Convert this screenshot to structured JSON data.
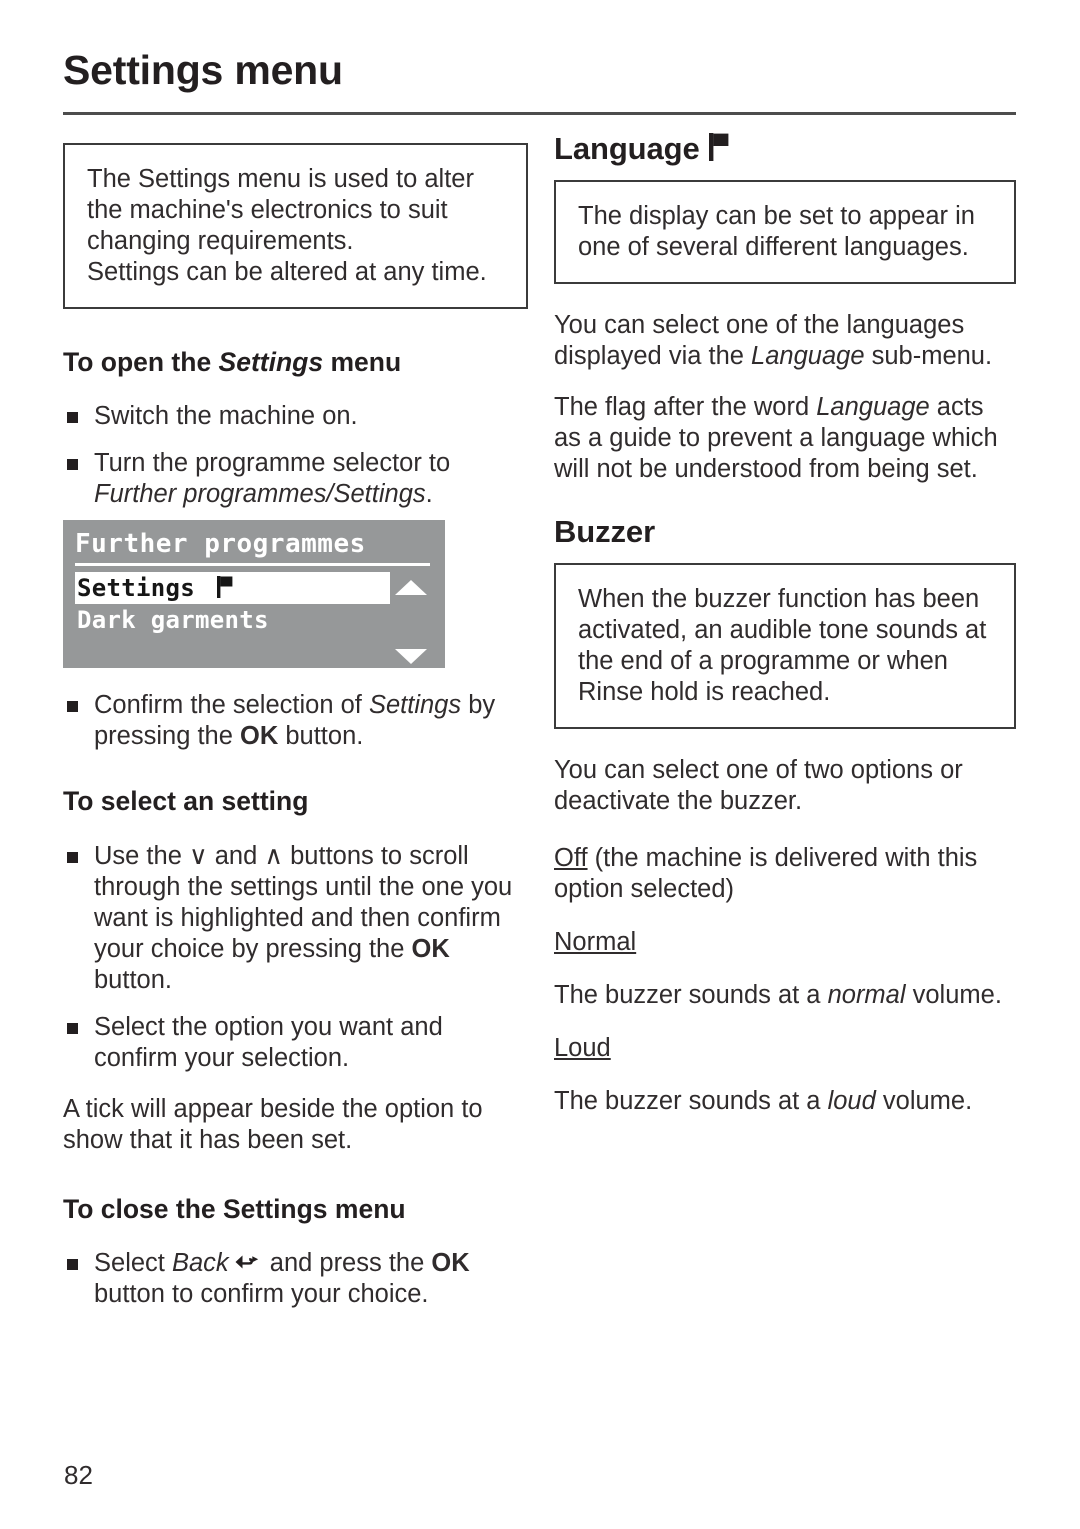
{
  "document": {
    "page_title": "Settings menu",
    "page_number": "82"
  },
  "left_column": {
    "intro_box": {
      "line1": "The Settings menu is used to alter the machine's electronics to suit changing requirements.",
      "line2": "Settings can be altered at any time."
    },
    "heading_open": {
      "part1": "To open the ",
      "italic": "Settings",
      "part2": " menu"
    },
    "bullet_switch_on": "Switch the machine on.",
    "bullet_turn_selector": {
      "text": "Turn the programme selector to ",
      "italic": "Further programmes/Settings",
      "tail": "."
    },
    "lcd": {
      "title": "Further programmes",
      "row_selected": "Settings",
      "row_selected_icon": "flag-icon",
      "row_next": "Dark garments",
      "scroll_up_icon": "triangle-up-icon",
      "scroll_down_icon": "triangle-down-icon"
    },
    "bullet_confirm": {
      "part1": "Confirm the selection of ",
      "italic": "Settings",
      "part2": " by pressing the ",
      "bold": "OK",
      "part3": " button."
    },
    "heading_select": "To select an setting",
    "bullet_use_buttons": {
      "part1": "Use the ",
      "sym_down": "∨",
      "part2": " and ",
      "sym_up": "∧",
      "part3": "  buttons to scroll through the settings until the one you want is highlighted and then confirm your choice by pressing the ",
      "bold": "OK",
      "part4": " button."
    },
    "bullet_select_option": "Select the option you want and confirm your selection.",
    "tick_paragraph": "A tick will appear beside the option to show that it has been set.",
    "heading_close": "To close the Settings menu",
    "bullet_back": {
      "part1": "Select ",
      "italic": "Back",
      "icon": "back-arrow-icon",
      "part2": " and press the ",
      "bold": "OK",
      "part3": " button to confirm your choice."
    }
  },
  "right_column": {
    "language": {
      "heading": "Language",
      "heading_icon": "flag-icon",
      "note_box": "The display can be set to appear in one of several different languages.",
      "para1": {
        "part1": "You can select one of the languages displayed via the ",
        "italic": "Language",
        "part2": " sub-menu."
      },
      "para2": {
        "part1": "The flag after the word ",
        "italic": "Language",
        "part2": " acts as a guide to prevent a language which will not be understood from being set."
      }
    },
    "buzzer": {
      "heading": "Buzzer",
      "note_box": "When the buzzer function has been activated, an audible tone sounds at the end of a programme or when Rinse hold is reached.",
      "para1": "You can select one of two options or deactivate the buzzer.",
      "option_off": {
        "underlined": "Off",
        "rest": " (the machine is delivered with this option selected)"
      },
      "option_normal": {
        "underlined": "Normal",
        "description": {
          "part1": "The buzzer sounds at a ",
          "italic": "normal",
          "part2": " volume."
        }
      },
      "option_loud": {
        "underlined": "Loud",
        "description": {
          "part1": "The buzzer sounds at a ",
          "italic": "loud",
          "part2": " volume."
        }
      }
    }
  },
  "colors": {
    "text": "#302c2d",
    "heading": "#231f20",
    "rule": "#4d4d4d",
    "box_border": "#3b3b3b",
    "lcd_background": "#969899",
    "lcd_text": "#ffffff",
    "lcd_selected_background": "#ffffff",
    "lcd_selected_text": "#161616"
  }
}
